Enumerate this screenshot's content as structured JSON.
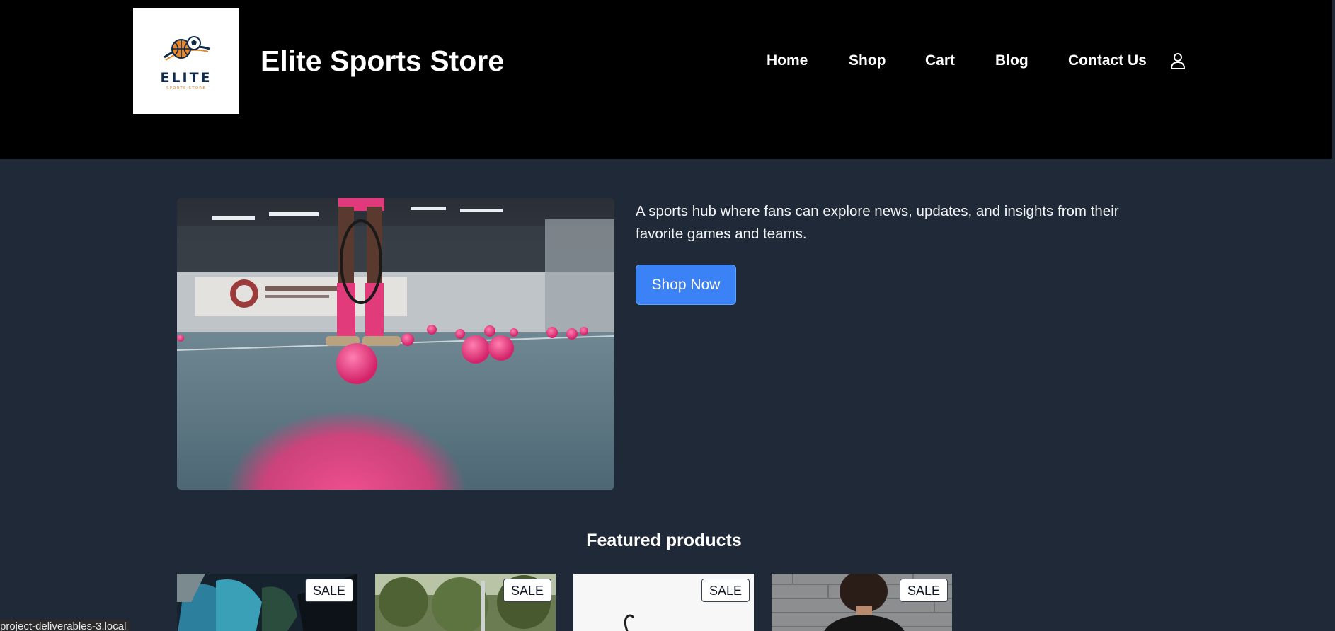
{
  "header": {
    "logo": {
      "word": "ELITE",
      "sub": "SPORTS STORE"
    },
    "title": "Elite Sports Store",
    "nav": [
      {
        "label": "Home"
      },
      {
        "label": "Shop"
      },
      {
        "label": "Cart"
      },
      {
        "label": "Blog"
      },
      {
        "label": "Contact Us"
      }
    ],
    "user_icon": "user-icon"
  },
  "hero": {
    "image": "tennis-court-photo",
    "text": "A sports hub where fans can explore news, updates, and insights from their favorite games and teams.",
    "button_label": "Shop Now"
  },
  "featured": {
    "title": "Featured products",
    "products": [
      {
        "badge": "SALE",
        "image": "goalkeeper-gloves-photo"
      },
      {
        "badge": "SALE",
        "image": "outdoor-field-photo"
      },
      {
        "badge": "SALE",
        "image": "white-product-photo"
      },
      {
        "badge": "SALE",
        "image": "athlete-brick-wall-photo"
      }
    ]
  },
  "status_bar": {
    "text": "project-deliverables-3.local"
  },
  "colors": {
    "header_bg": "#000000",
    "page_bg": "#1f2937",
    "accent": "#3b82f6",
    "text": "#ffffff"
  }
}
